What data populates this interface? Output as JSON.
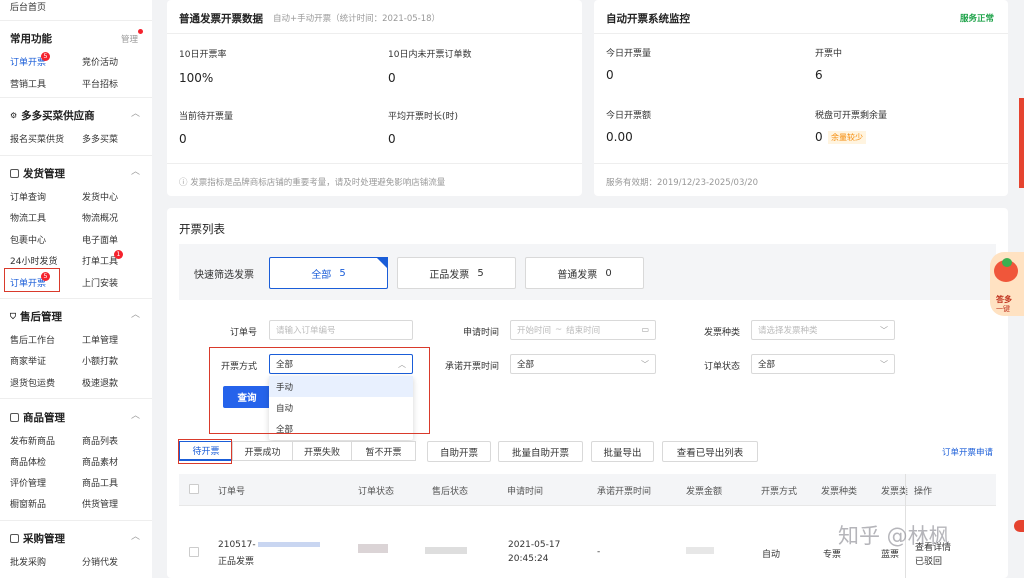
{
  "sidebar": {
    "top_link": "后台首页",
    "common": {
      "title": "常用功能",
      "manage": "管理",
      "items": [
        {
          "label": "订单开票",
          "badge": "5"
        },
        {
          "label": "竞价活动"
        },
        {
          "label": "营销工具"
        },
        {
          "label": "平台招标"
        }
      ]
    },
    "duoduo": {
      "title": "多多买菜供应商",
      "items": [
        {
          "label": "报名买菜供货"
        },
        {
          "label": "多多买菜"
        }
      ]
    },
    "shipping": {
      "title": "发货管理",
      "items": [
        {
          "label": "订单查询"
        },
        {
          "label": "发货中心"
        },
        {
          "label": "物流工具"
        },
        {
          "label": "物流概况"
        },
        {
          "label": "包裹中心"
        },
        {
          "label": "电子面单"
        },
        {
          "label": "24小时发货"
        },
        {
          "label": "打单工具",
          "badge": "1"
        },
        {
          "label": "订单开票",
          "badge": "5"
        },
        {
          "label": "上门安装"
        }
      ]
    },
    "aftersale": {
      "title": "售后管理",
      "items": [
        {
          "label": "售后工作台"
        },
        {
          "label": "工单管理"
        },
        {
          "label": "商家举证"
        },
        {
          "label": "小额打款"
        },
        {
          "label": "退货包运费"
        },
        {
          "label": "极速退款"
        }
      ]
    },
    "goods": {
      "title": "商品管理",
      "items": [
        {
          "label": "发布新商品"
        },
        {
          "label": "商品列表"
        },
        {
          "label": "商品体检"
        },
        {
          "label": "商品素材"
        },
        {
          "label": "评价管理"
        },
        {
          "label": "商品工具"
        },
        {
          "label": "橱窗新品"
        },
        {
          "label": "供货管理"
        }
      ]
    },
    "purchase": {
      "title": "采购管理",
      "items": [
        {
          "label": "批发采购"
        },
        {
          "label": "分销代发"
        }
      ]
    }
  },
  "invoice_data": {
    "title": "普通发票开票数据",
    "subtitle": "自动+手动开票（统计时间：2021-05-18）",
    "stats": [
      {
        "label": "10日开票率",
        "value": "100%"
      },
      {
        "label": "10日内未开票订单数",
        "value": "0"
      },
      {
        "label": "当前待开票量",
        "value": "0"
      },
      {
        "label": "平均开票时长(时)",
        "value": "0"
      }
    ],
    "footer": "发票指标是品牌商标店铺的重要考量，请及时处理避免影响店铺流量"
  },
  "monitor": {
    "title": "自动开票系统监控",
    "status": "服务正常",
    "stats": [
      {
        "label": "今日开票量",
        "value": "0"
      },
      {
        "label": "开票中",
        "value": "6"
      },
      {
        "label": "今日开票额",
        "value": "0.00"
      },
      {
        "label": "税盘可开票剩余量",
        "value": "0"
      }
    ],
    "warn": "余量较少",
    "footer": "服务有效期：2019/12/23-2025/03/20"
  },
  "list": {
    "title": "开票列表",
    "quick_filter_label": "快速筛选发票",
    "chips": [
      {
        "label": "全部",
        "count": "5"
      },
      {
        "label": "正品发票",
        "count": "5"
      },
      {
        "label": "普通发票",
        "count": "0"
      }
    ],
    "filters": {
      "order_no_label": "订单号",
      "order_no_placeholder": "请输入订单编号",
      "apply_time_label": "申请时间",
      "apply_start": "开始时间",
      "apply_sep": "~",
      "apply_end": "结束时间",
      "invoice_type_label": "发票种类",
      "invoice_type_placeholder": "请选择发票种类",
      "method_label": "开票方式",
      "method_value": "全部",
      "promise_label": "承诺开票时间",
      "promise_value": "全部",
      "order_status_label": "订单状态",
      "order_status_value": "全部",
      "method_options": [
        "手动",
        "自动",
        "全部"
      ],
      "query": "查询"
    },
    "tabs": [
      "待开票",
      "开票成功",
      "开票失败",
      "暂不开票"
    ],
    "actions": [
      "自助开票",
      "批量自助开票",
      "批量导出",
      "查看已导出列表"
    ],
    "right_link": "订单开票申请",
    "columns": [
      "订单号",
      "订单状态",
      "售后状态",
      "申请时间",
      "承诺开票时间",
      "发票金额",
      "开票方式",
      "发票种类",
      "发票类",
      "操作"
    ],
    "row": {
      "order_no": "210517-",
      "order_tag": "正品发票",
      "apply_date": "2021-05-17",
      "apply_time": "20:45:24",
      "promise": "-",
      "method": "自动",
      "kind": "专票",
      "type": "蓝票",
      "op": "查看详情",
      "op2": "已驳回"
    }
  },
  "watermark": "知乎 @林枫",
  "promo": {
    "line1": "答多",
    "line2": "一键"
  }
}
